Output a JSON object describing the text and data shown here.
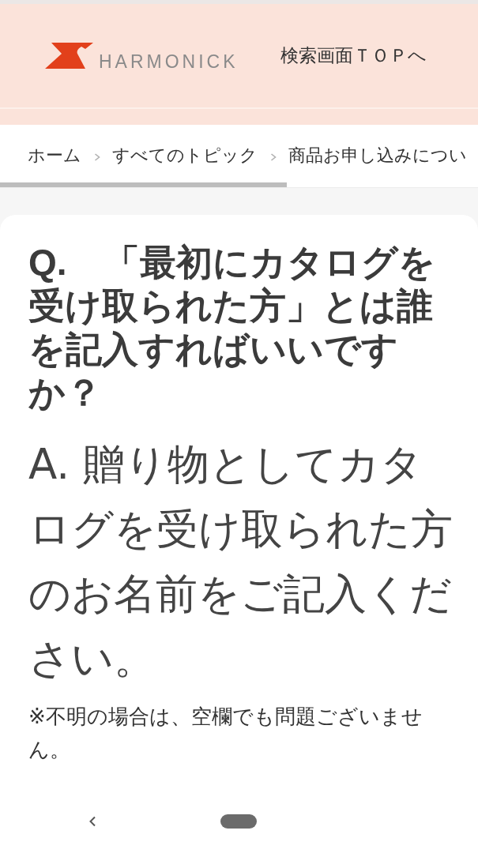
{
  "header": {
    "logo_text": "HARMONICK",
    "top_link": "検索画面ＴＯＰへ"
  },
  "breadcrumb": [
    {
      "label": "ホーム"
    },
    {
      "label": "すべてのトピック"
    },
    {
      "label": "商品お申し込みについ"
    }
  ],
  "faq": {
    "question": "Q.　「最初にカタログを受け取られた方」とは誰を記入すればいいですか？",
    "answer": "A. 贈り物としてカタログを受け取られた方のお名前をご記入ください。",
    "note": "※不明の場合は、空欄でも問題ございません。"
  }
}
